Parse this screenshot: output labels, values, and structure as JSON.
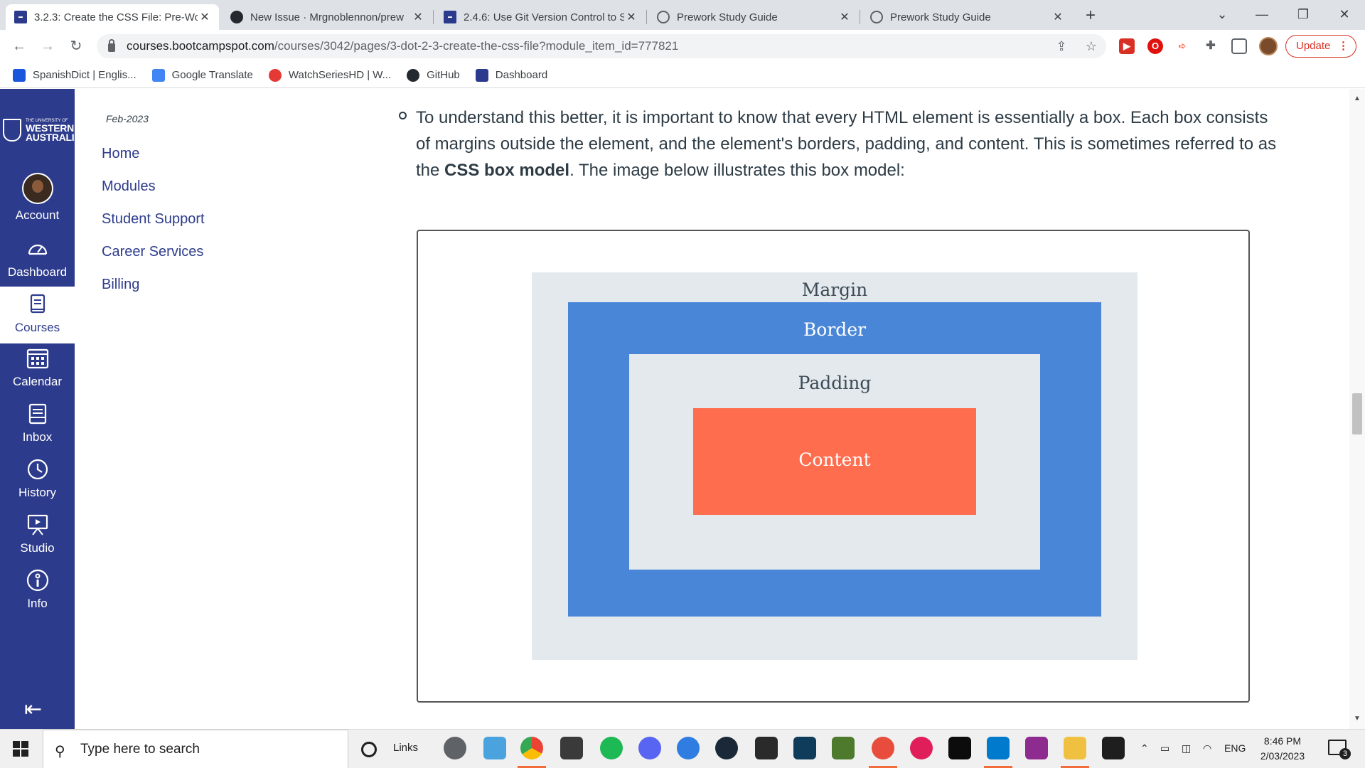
{
  "browser": {
    "tabs": [
      {
        "title": "3.2.3: Create the CSS File: Pre-Wo",
        "favicon": "canvas-favicon",
        "active": true
      },
      {
        "title": "New Issue · Mrgnoblennon/prew",
        "favicon": "github-favicon",
        "active": false
      },
      {
        "title": "2.4.6: Use Git Version Control to S",
        "favicon": "canvas-favicon",
        "active": false
      },
      {
        "title": "Prework Study Guide",
        "favicon": "globe-favicon",
        "active": false
      },
      {
        "title": "Prework Study Guide",
        "favicon": "globe-favicon",
        "active": false
      }
    ],
    "url_host": "courses.bootcampspot.com",
    "url_path": "/courses/3042/pages/3-dot-2-3-create-the-css-file?module_item_id=777821",
    "update_label": "Update",
    "bookmarks": [
      {
        "label": "SpanishDict | Englis...",
        "color": "#1a56db"
      },
      {
        "label": "Google Translate",
        "color": "#4285f4"
      },
      {
        "label": "WatchSeriesHD | W...",
        "color": "#e53935"
      },
      {
        "label": "GitHub",
        "color": "#24292f"
      },
      {
        "label": "Dashboard",
        "color": "#2b3a8c"
      }
    ]
  },
  "global_nav": {
    "logo_small": "THE UNIVERSITY OF",
    "logo_big_1": "WESTERN",
    "logo_big_2": "AUSTRALIA",
    "items": [
      {
        "label": "Account",
        "icon": "avatar"
      },
      {
        "label": "Dashboard",
        "icon": "dashboard-icon"
      },
      {
        "label": "Courses",
        "icon": "courses-icon",
        "active": true
      },
      {
        "label": "Calendar",
        "icon": "calendar-icon"
      },
      {
        "label": "Inbox",
        "icon": "inbox-icon"
      },
      {
        "label": "History",
        "icon": "history-icon"
      },
      {
        "label": "Studio",
        "icon": "studio-icon"
      },
      {
        "label": "Info",
        "icon": "info-icon"
      }
    ],
    "colors": {
      "nav_bg": "#2d3b8c",
      "nav_text": "#ffffff"
    }
  },
  "course_nav": {
    "term": "Feb-2023",
    "links": [
      "Home",
      "Modules",
      "Student Support",
      "Career Services",
      "Billing"
    ]
  },
  "content": {
    "para_part1": "To understand this better, it is important to know that every HTML element is essentially a box. Each box consists of margins outside the element, and the element's borders, padding, and content. This is sometimes referred to as the ",
    "para_bold": "CSS box model",
    "para_part2": ". The image below illustrates this box model:",
    "box_model": {
      "margin_label": "Margin",
      "border_label": "Border",
      "padding_label": "Padding",
      "content_label": "Content",
      "colors": {
        "margin": "#e3e9ec",
        "border": "#4a86d8",
        "padding": "#e3e9ec",
        "content": "#ff6d4f"
      }
    }
  },
  "taskbar": {
    "search_placeholder": "Type here to search",
    "links_label": "Links",
    "language": "ENG",
    "time": "8:46 PM",
    "date": "2/03/2023",
    "notification_count": "3"
  }
}
